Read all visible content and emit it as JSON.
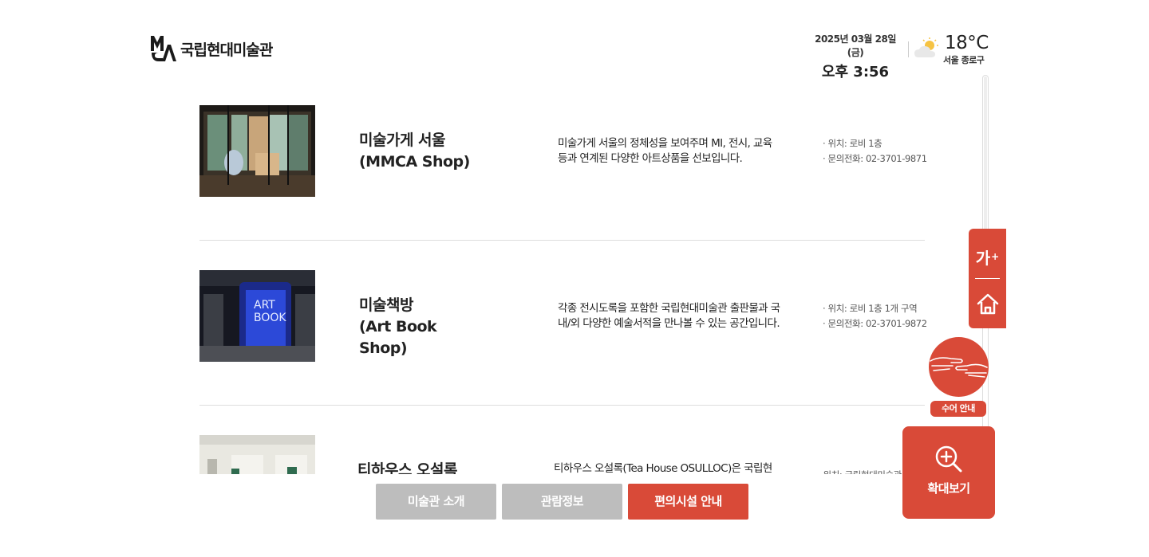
{
  "header": {
    "logo_text": "국립현대미술관",
    "date": "2025년 03월 28일 (금)",
    "time": "오후 3:56",
    "temperature": "18°C",
    "location": "서울 종로구",
    "weather_icon": "partly-cloudy-icon"
  },
  "facilities": [
    {
      "name": "미술가게 서울\n(MMCA Shop)",
      "desc": "미술가게 서울의 정체성을 보여주며 MI, 전시, 교육 등과 연계된 다양한 아트상품을 선보입니다.",
      "location": "· 위치: 로비 1층",
      "phone": "· 문의전화: 02-3701-9871"
    },
    {
      "name": "미술책방\n(Art Book\nShop)",
      "desc": "각종 전시도록을 포함한 국립현대미술관 출판물과 국내/외 다양한 예술서적을 만나볼 수 있는 공간입니다.",
      "location": "· 위치: 로비 1층 1개 구역",
      "phone": "· 문의전화: 02-3701-9872",
      "sign_text": "ART\nBOOK"
    },
    {
      "name": "티하우스 오설록",
      "desc": "티하우스 오설록(Tea House OSULLOC)은 국립현대미술관 서울에 위치하여 미술관 외부 마당과",
      "location": "· 위치: 국립현대미술관",
      "phone": ""
    }
  ],
  "side": {
    "font_size_label": "가",
    "font_size_plus": "+",
    "home_icon": "home-icon",
    "sign_language_label": "수어 안내",
    "zoom_label": "확대보기"
  },
  "tabs": [
    {
      "label": "미술관 소개",
      "active": false
    },
    {
      "label": "관람정보",
      "active": false
    },
    {
      "label": "편의시설 안내",
      "active": true
    }
  ],
  "colors": {
    "accent": "#d94a38",
    "tab_inactive": "#bdbdbd"
  }
}
